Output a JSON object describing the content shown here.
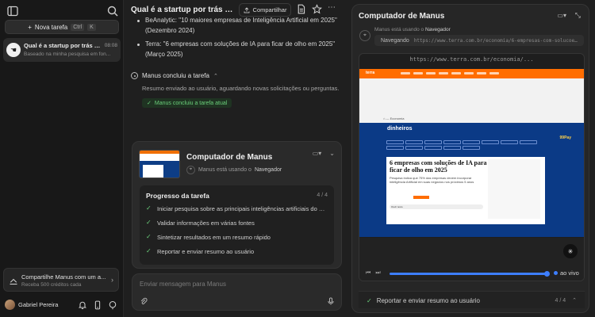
{
  "sidebar": {
    "new_task_label": "Nova tarefa",
    "new_task_shortcut_ctrl": "Ctrl",
    "new_task_shortcut_key": "K",
    "task": {
      "title": "Qual é a startup por trás do ...",
      "time": "08:08",
      "subtitle": "Baseado na minha pesquisa em fon..."
    },
    "share": {
      "title": "Compartilhe Manus com um a...",
      "subtitle": "Receba 500 créditos cada"
    },
    "user_name": "Gabriel Pereira"
  },
  "main": {
    "title": "Qual é a startup por trás do...",
    "share_button": "Compartilhar",
    "bullets": [
      "BeAnalytic: \"10 maiores empresas de Inteligência Artificial em 2025\" (Dezembro 2024)",
      "Terra: \"6 empresas com soluções de IA para ficar de olho em 2025\" (Março 2025)"
    ],
    "task_done": "Manus concluiu a tarefa",
    "task_done_desc": "Resumo enviado ao usuário, aguardando novas solicitações ou perguntas.",
    "task_done_badge": "Manus concluiu a tarefa atual",
    "card": {
      "title": "Computador de Manus",
      "status_prefix": "Manus está usando o",
      "status_tool": "Navegador",
      "progress_title": "Progresso da tarefa",
      "progress_count": "4 / 4",
      "steps": [
        "Iniciar pesquisa sobre as principais inteligências artificiais do m...",
        "Validar informações em várias fontes",
        "Sintetizar resultados em um resumo rápido",
        "Reportar e enviar resumo ao usuário"
      ]
    },
    "input_placeholder": "Enviar mensagem para Manus"
  },
  "panel": {
    "title": "Computador de Manus",
    "status_prefix": "Manus está usando o",
    "status_tool": "Navegador",
    "nav_label": "Navegando",
    "nav_url": "https://www.terra.com.br/economia/6-empresas-com-solucoes-...",
    "browser_url": "https://www.terra.com.br/economia/...",
    "site": {
      "logo": "terra",
      "brand": "dinheiros",
      "pay_brand": "99Pay",
      "headline": "6 empresas com soluções de IA para ficar de olho em 2025",
      "lead": "Pesquisa indica que 75% das empresas devem incorporar inteligência Artificial em suas negócios nos próximos 5 anos",
      "audio_label": "Ouvir texto"
    },
    "live_label": "ao vivo",
    "footer_step": "Reportar e enviar resumo ao usuário",
    "footer_count": "4 / 4"
  }
}
